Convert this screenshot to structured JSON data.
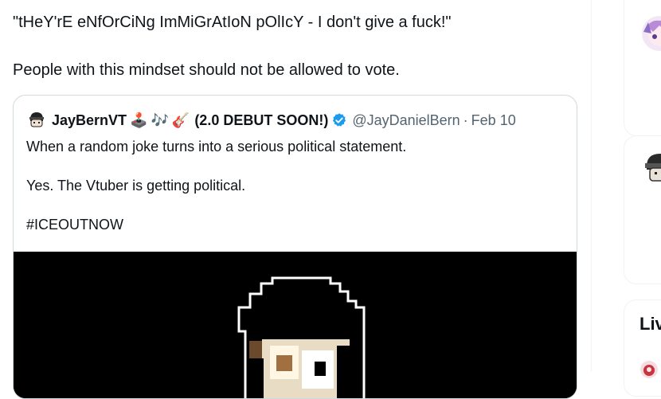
{
  "tweet": {
    "line1": "\"tHeY'rE eNfOrCiNg ImMiGrAtIoN pOlIcY - I don't give a fuck!\"",
    "line2": "People with this mindset should not be allowed to vote."
  },
  "quote": {
    "author_name": "JayBernVT",
    "emojis": [
      "🕹️",
      "🎶",
      "🎸"
    ],
    "name_suffix": "(2.0 DEBUT SOON!)",
    "handle": "@JayDanielBern",
    "separator": "·",
    "date": "Feb 10",
    "body_lines": [
      "When a random joke turns into a serious political statement.",
      "Yes. The Vtuber is getting political.",
      "#ICEOUTNOW"
    ],
    "verified_color": "#1d9bf0",
    "media_background": "#000000"
  },
  "sidebar": {
    "section_title_partial": "Liv"
  },
  "colors": {
    "text": "#0f1419",
    "secondary": "#536471",
    "border": "#cfd9de"
  }
}
